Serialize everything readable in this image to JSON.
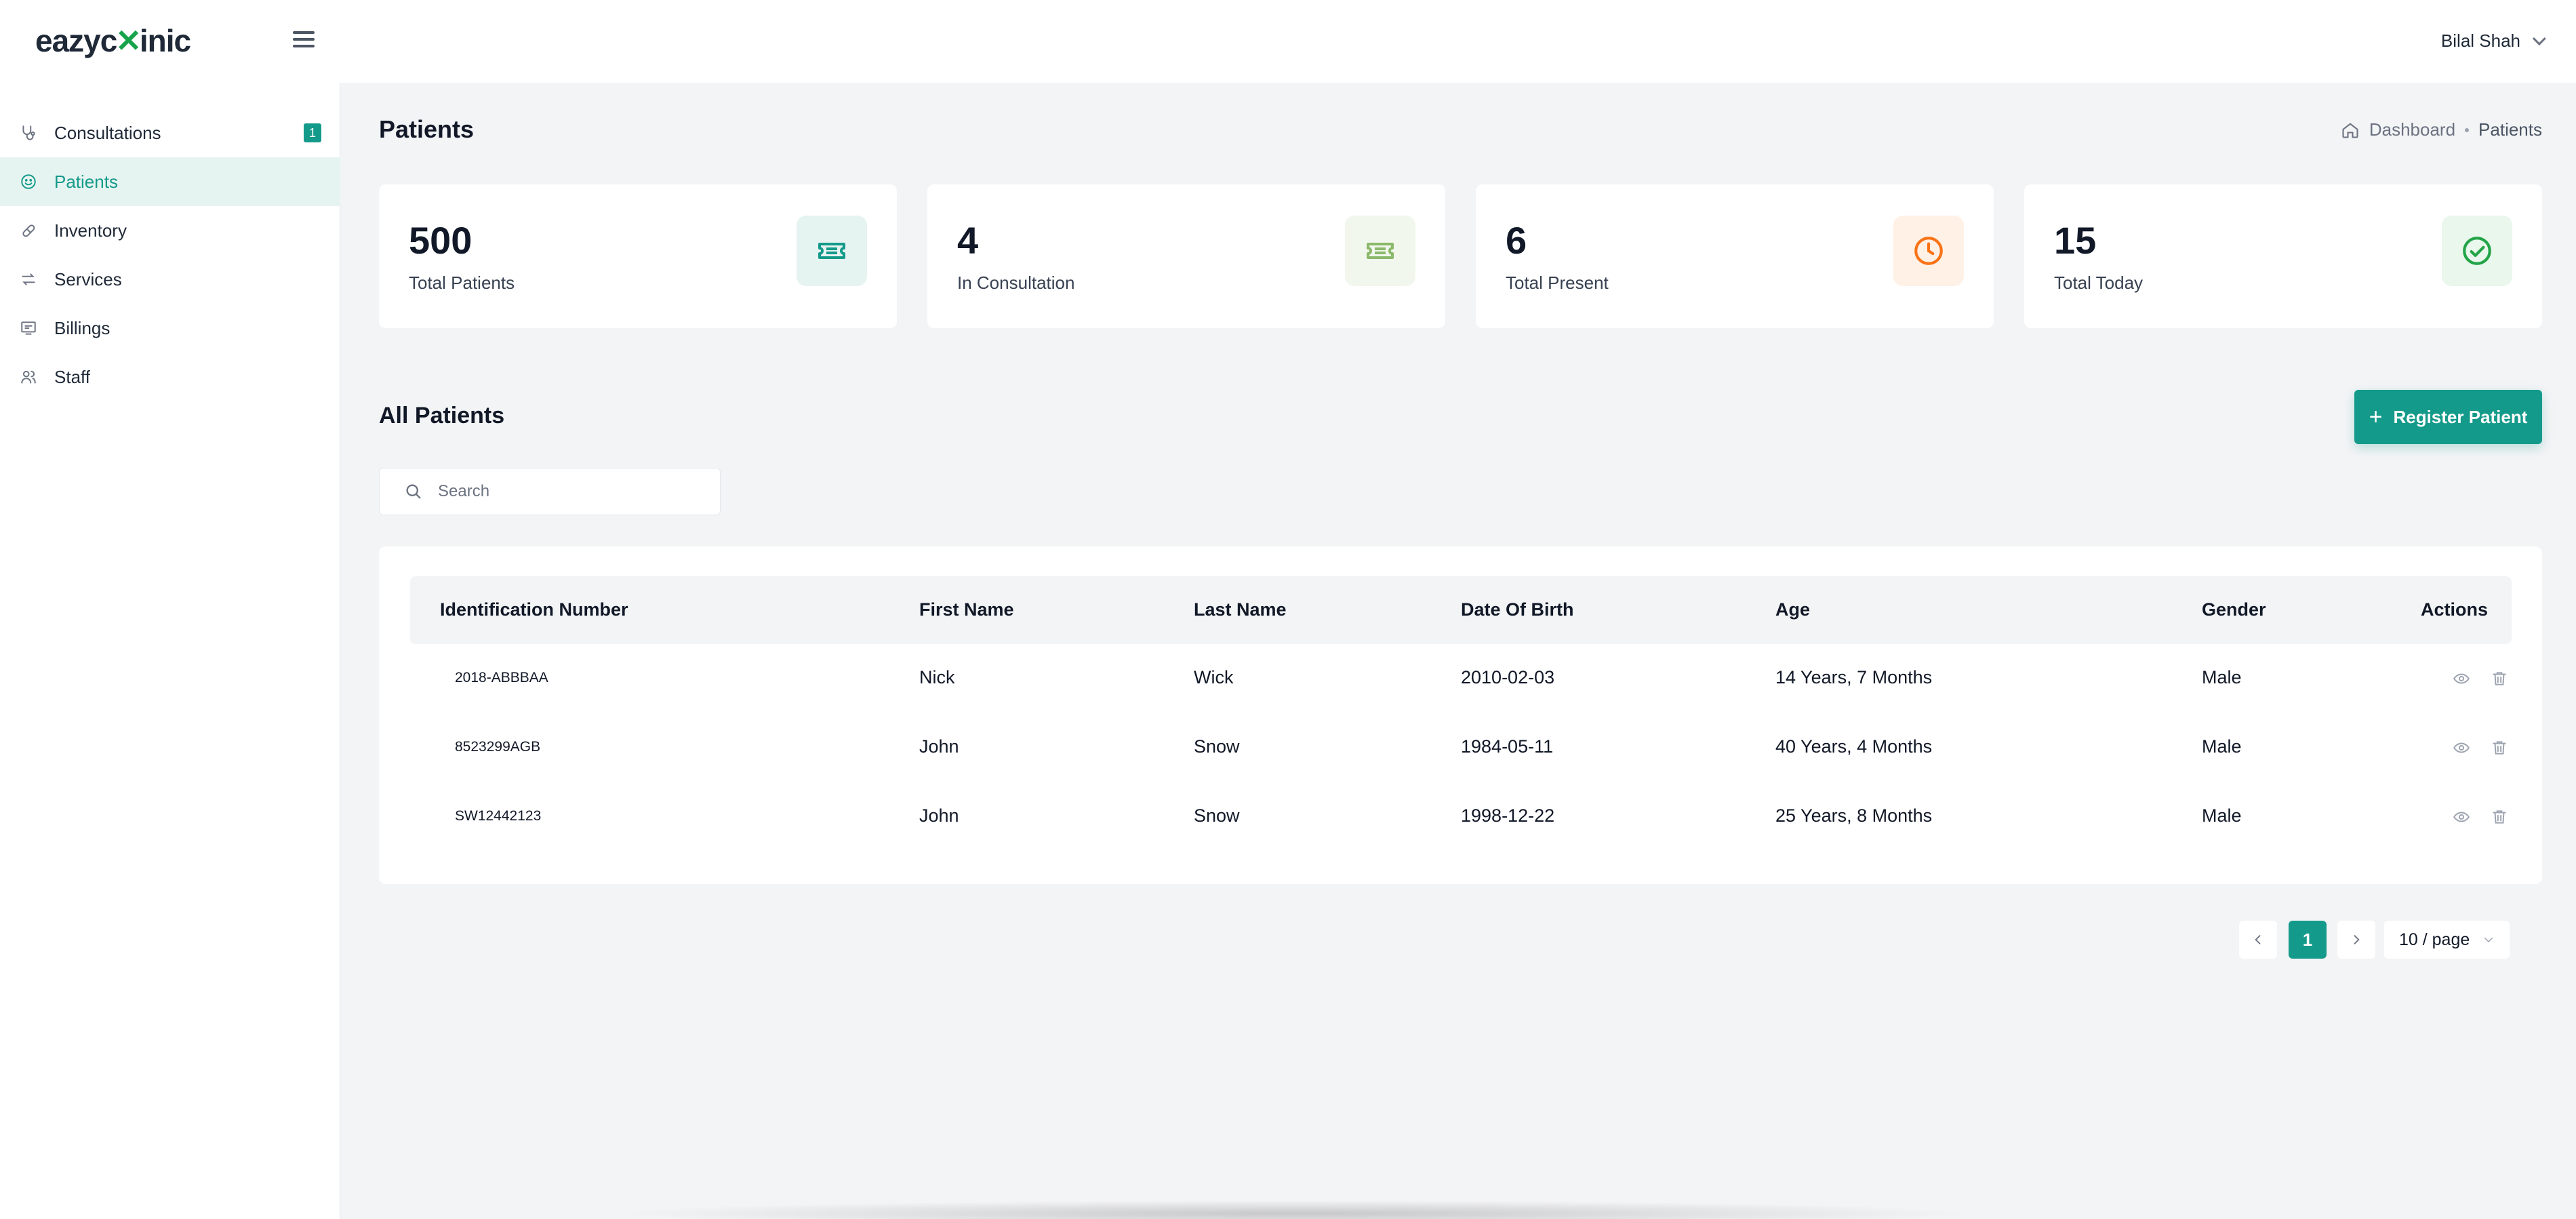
{
  "app": {
    "logo_left": "eazyc",
    "logo_accent": "✕",
    "logo_right": "inic"
  },
  "header": {
    "user_name": "Bilal Shah"
  },
  "sidebar": {
    "items": [
      {
        "label": "Consultations",
        "icon": "stethoscope-icon",
        "badge": "1"
      },
      {
        "label": "Patients",
        "icon": "smile-icon",
        "active": true
      },
      {
        "label": "Inventory",
        "icon": "pill-icon"
      },
      {
        "label": "Services",
        "icon": "transfer-icon"
      },
      {
        "label": "Billings",
        "icon": "receipt-icon"
      },
      {
        "label": "Staff",
        "icon": "users-icon"
      }
    ]
  },
  "page": {
    "title": "Patients",
    "breadcrumb": [
      "Dashboard",
      "Patients"
    ]
  },
  "stats": [
    {
      "value": "500",
      "label": "Total Patients",
      "icon": "ticket-icon",
      "icon_color": "#149a8a",
      "icon_bg": "#e6f4f1"
    },
    {
      "value": "4",
      "label": "In Consultation",
      "icon": "ticket-icon",
      "icon_color": "#8bb86a",
      "icon_bg": "#f1f7ec"
    },
    {
      "value": "6",
      "label": "Total Present",
      "icon": "clock-icon",
      "icon_color": "#f97316",
      "icon_bg": "#fff1e6"
    },
    {
      "value": "15",
      "label": "Total Today",
      "icon": "check-circle-icon",
      "icon_color": "#22a447",
      "icon_bg": "#e9f7ec"
    }
  ],
  "patients_section": {
    "title": "All Patients",
    "register_label": "Register Patient",
    "search_placeholder": "Search"
  },
  "table": {
    "columns": [
      "Identification Number",
      "First Name",
      "Last Name",
      "Date Of Birth",
      "Age",
      "Gender",
      "Actions"
    ],
    "rows": [
      {
        "id": "2018-ABBBAA",
        "first": "Nick",
        "last": "Wick",
        "dob": "2010-02-03",
        "age": "14 Years, 7 Months",
        "gender": "Male"
      },
      {
        "id": "8523299AGB",
        "first": "John",
        "last": "Snow",
        "dob": "1984-05-11",
        "age": "40 Years, 4 Months",
        "gender": "Male"
      },
      {
        "id": "SW12442123",
        "first": "John",
        "last": "Snow",
        "dob": "1998-12-22",
        "age": "25 Years, 8 Months",
        "gender": "Male"
      }
    ]
  },
  "pagination": {
    "current_page": "1",
    "page_size": "10 / page"
  },
  "colors": {
    "accent": "#149a8a"
  }
}
